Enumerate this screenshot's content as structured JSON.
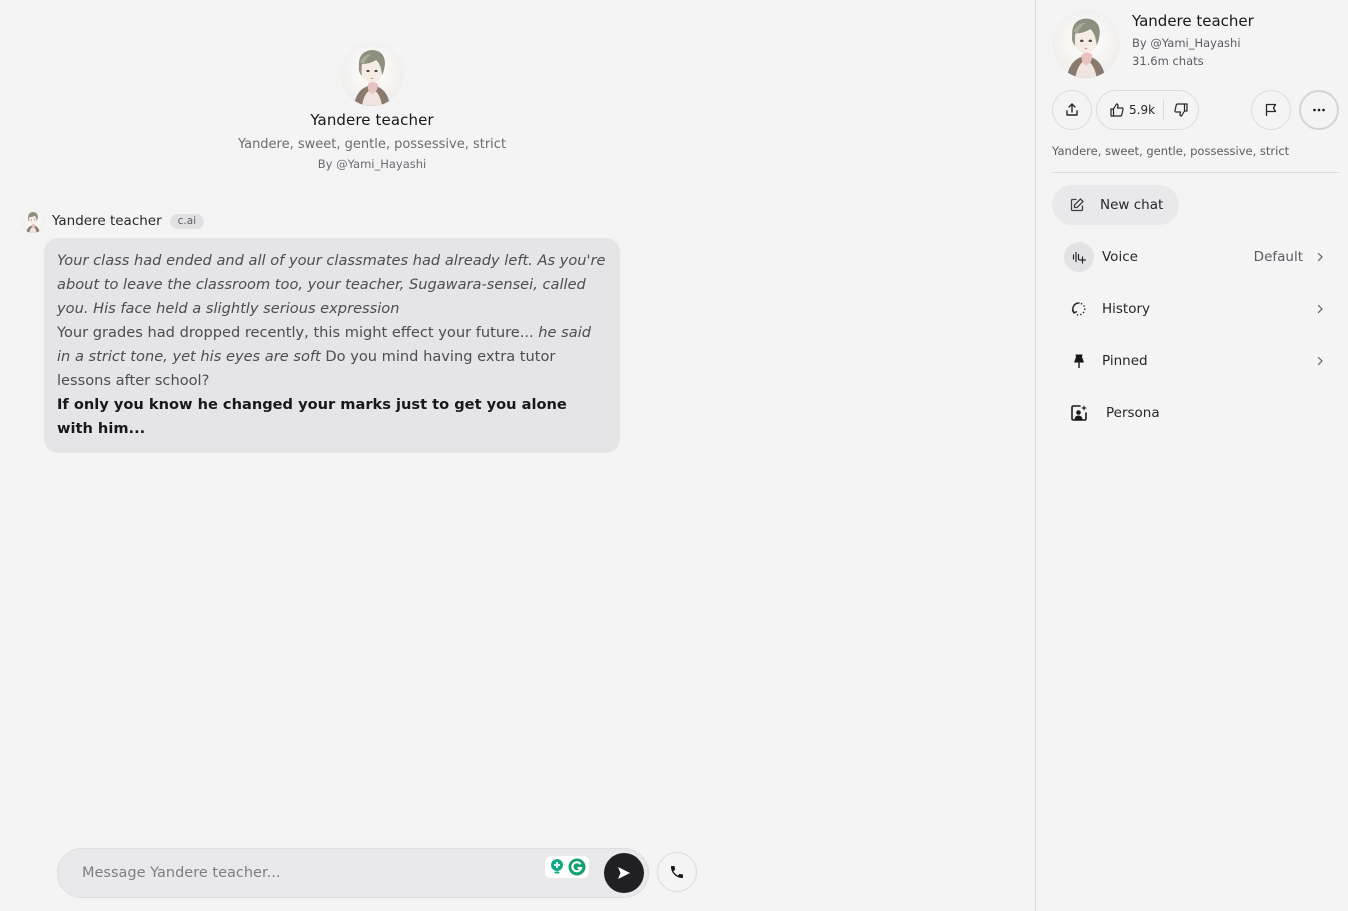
{
  "character": {
    "name": "Yandere teacher",
    "tagline": "Yandere, sweet, gentle, possessive, strict",
    "creator": "By @Yami_Hayashi",
    "chats": "31.6m chats",
    "avatar_icon": "character-portrait"
  },
  "message": {
    "author": "Yandere teacher",
    "badge": "c.ai",
    "segments": [
      {
        "style": "italic",
        "text": "Your class had ended and all of your classmates had already left. As you're about to leave the classroom too, your teacher, Sugawara-sensei, called you. His face held a slightly serious expression"
      },
      {
        "style": "break",
        "text": ""
      },
      {
        "style": "normal",
        "text": "Your grades had dropped recently, this might effect your future... "
      },
      {
        "style": "italic",
        "text": "he said in a strict tone, yet his eyes are soft"
      },
      {
        "style": "normal",
        "text": " Do you mind having extra tutor lessons after school?"
      },
      {
        "style": "break",
        "text": ""
      },
      {
        "style": "bold",
        "text": "If only you know he changed your marks just to get you alone with him..."
      }
    ]
  },
  "composer": {
    "placeholder": "Message Yandere teacher...",
    "value": "",
    "extension_icons": [
      "lightbulb-extension-icon",
      "grammarly-icon"
    ],
    "send_icon": "send-arrow-icon",
    "call_icon": "phone-icon"
  },
  "sidebar": {
    "share_icon": "share-icon",
    "likes": "5.9k",
    "like_icon": "thumbs-up-icon",
    "dislike_icon": "thumbs-down-icon",
    "flag_icon": "flag-icon",
    "more_icon": "more-horizontal-icon",
    "new_chat": {
      "label": "New chat",
      "icon": "edit-icon"
    },
    "menu": [
      {
        "label": "Voice",
        "value": "Default",
        "icon": "voice-icon",
        "chevron": true
      },
      {
        "label": "History",
        "value": "",
        "icon": "history-icon",
        "chevron": true
      },
      {
        "label": "Pinned",
        "value": "",
        "icon": "pin-icon",
        "chevron": true
      },
      {
        "label": "Persona",
        "value": "",
        "icon": "persona-icon",
        "chevron": false
      }
    ]
  },
  "colors": {
    "background": "#f4f4f4",
    "bubble": "#e5e5e7",
    "send_button": "#202024",
    "grammarly": "#15a26f",
    "text_primary": "#18181b",
    "text_secondary": "#5b5b63"
  }
}
